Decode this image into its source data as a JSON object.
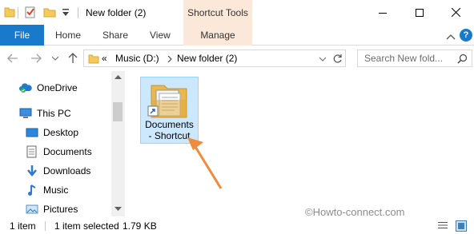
{
  "titlebar": {
    "title": "New folder (2)",
    "contextual_tab_group": "Shortcut Tools",
    "controls": [
      "minimize-icon",
      "maximize-icon",
      "close-icon"
    ]
  },
  "ribbon": {
    "tabs": [
      {
        "label": "File"
      },
      {
        "label": "Home"
      },
      {
        "label": "Share"
      },
      {
        "label": "View"
      },
      {
        "label": "Manage"
      }
    ],
    "help_label": "?"
  },
  "address": {
    "overflow": "«",
    "crumbs": [
      "Music (D:)",
      "New folder (2)"
    ],
    "search_placeholder": "Search New fold..."
  },
  "nav": {
    "items": [
      {
        "label": "OneDrive",
        "icon": "onedrive-icon"
      },
      {
        "label": "This PC",
        "icon": "computer-icon"
      },
      {
        "label": "Desktop",
        "icon": "desktop-icon"
      },
      {
        "label": "Documents",
        "icon": "documents-icon"
      },
      {
        "label": "Downloads",
        "icon": "downloads-icon"
      },
      {
        "label": "Music",
        "icon": "music-icon"
      },
      {
        "label": "Pictures",
        "icon": "pictures-icon"
      }
    ]
  },
  "content": {
    "files": [
      {
        "line1": "Documents",
        "line2": "- Shortcut",
        "icon": "shortcut-folder-icon",
        "selected": true
      }
    ]
  },
  "watermark": "©Howto-connect.com",
  "status": {
    "count": "1 item",
    "selection": "1 item selected",
    "size": "1.79 KB"
  },
  "colors": {
    "accent": "#1979ca",
    "contextual": "#fbe8d8",
    "selection": "#cce8ff",
    "arrow": "#f08a3c"
  }
}
